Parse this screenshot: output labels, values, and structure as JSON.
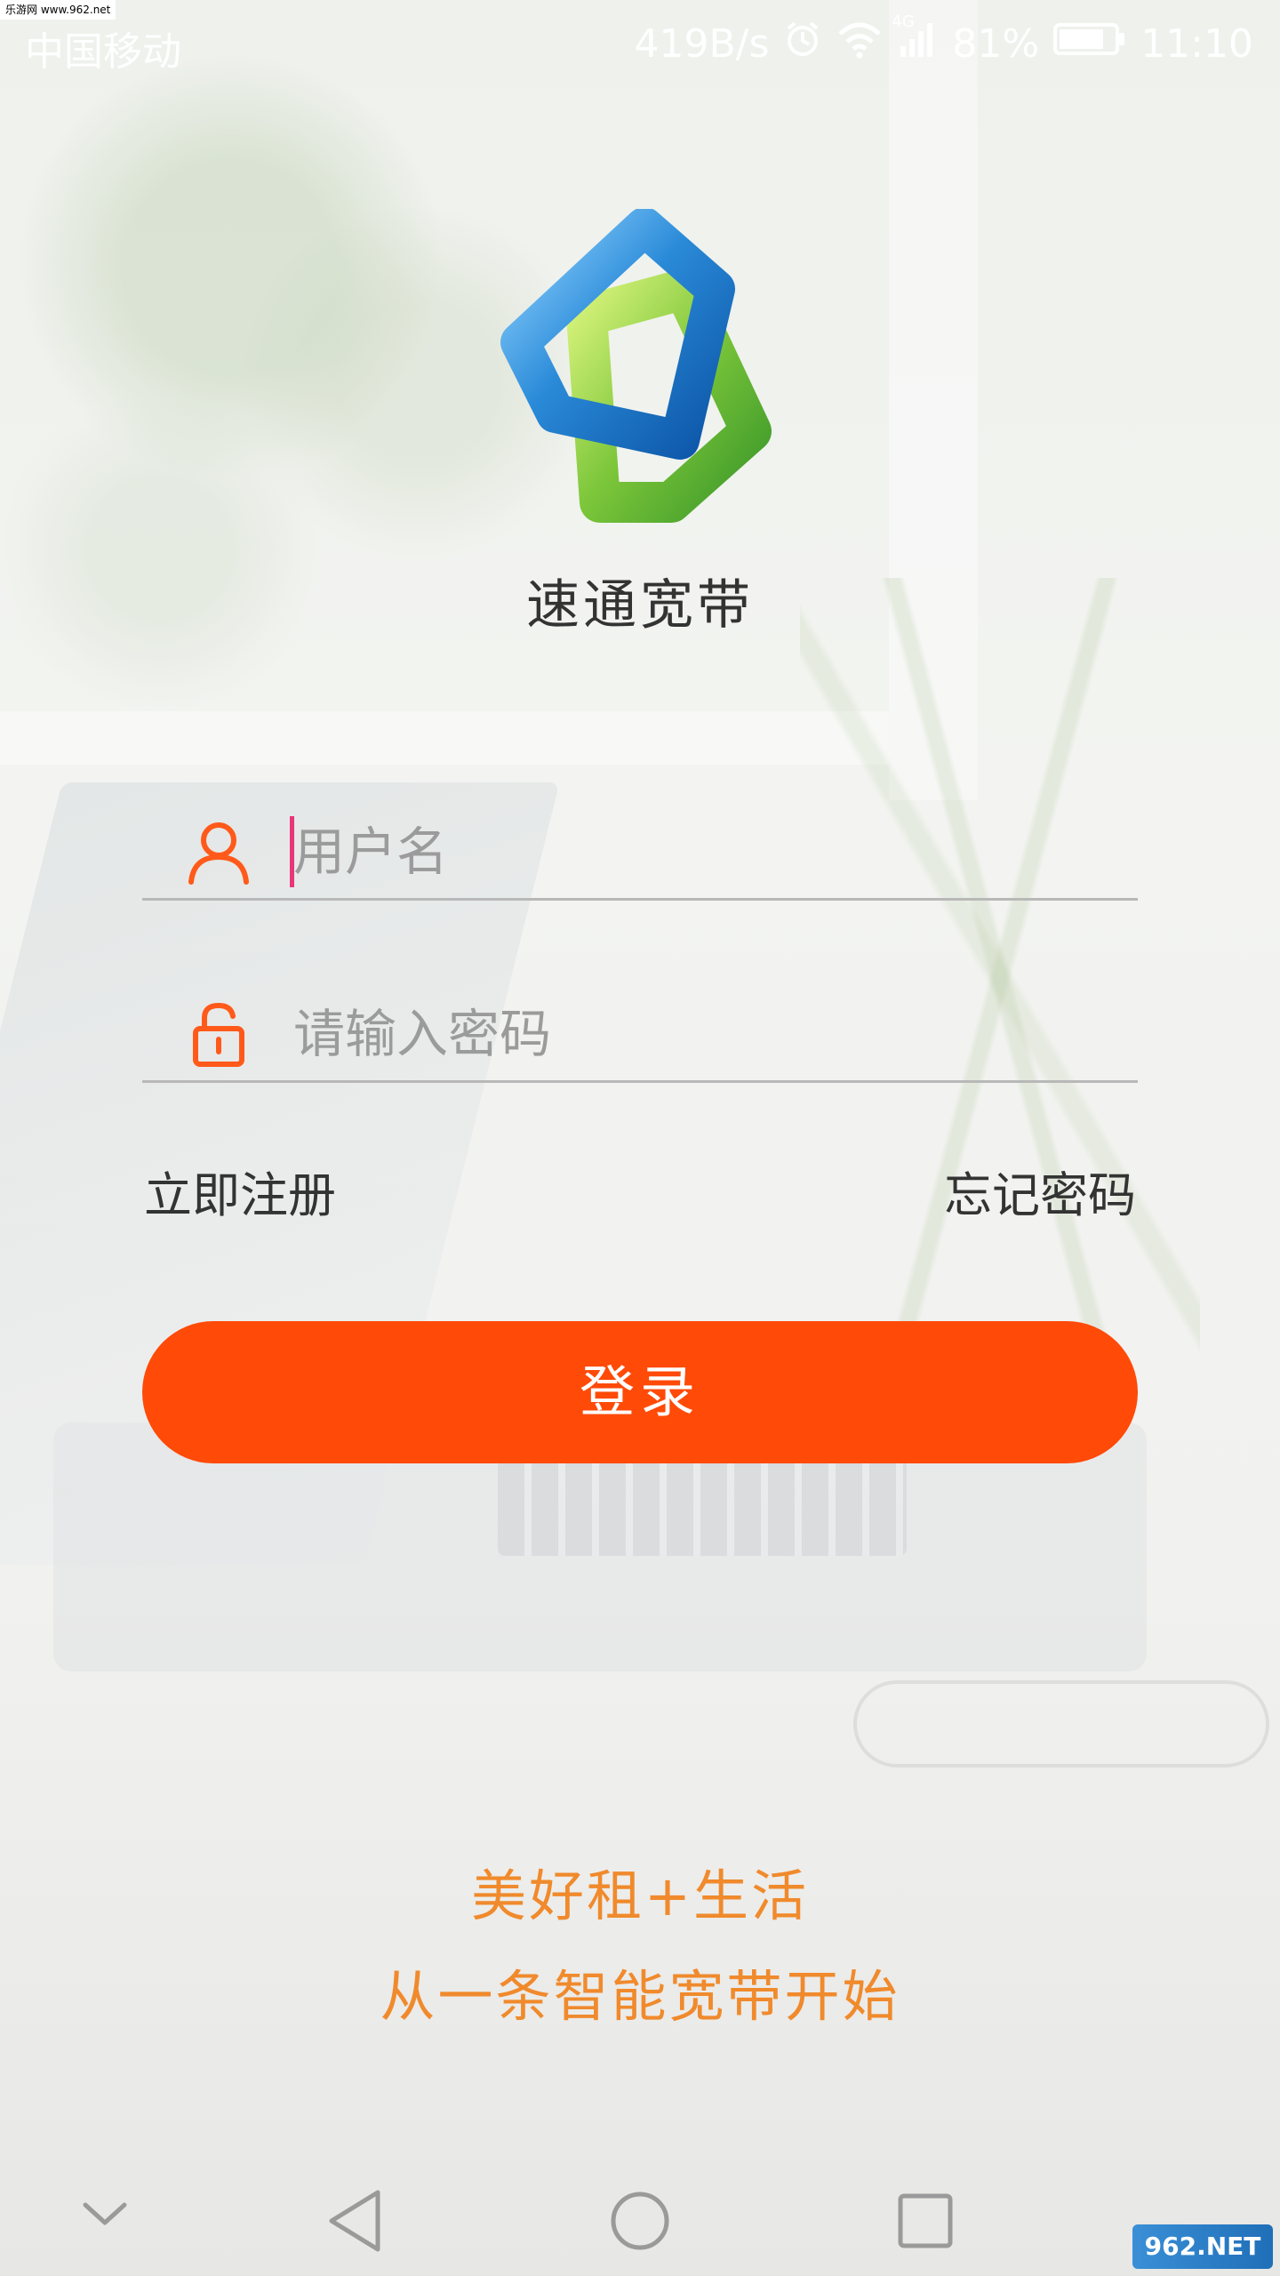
{
  "status_bar": {
    "carrier": "中国移动",
    "net_speed": "419B/s",
    "network_type": "4G",
    "battery": "81%",
    "time": "11:10"
  },
  "watermark_top": "乐游网 www.962.net",
  "app": {
    "name": "速通宽带"
  },
  "form": {
    "username_placeholder": "用户名",
    "password_placeholder": "请输入密码",
    "register_label": "立即注册",
    "forgot_label": "忘记密码",
    "login_label": "登录"
  },
  "slogan": {
    "line1": "美好租+生活",
    "line2": "从一条智能宽带开始"
  },
  "watermark_bottom": "962.NET",
  "colors": {
    "accent": "#ff4a08",
    "icon": "#ff5a1a",
    "slogan": "#f08a2c",
    "cursor": "#e8367a"
  },
  "icons": {
    "username": "user-icon",
    "password": "unlock-icon",
    "nav": [
      "chevron-down-icon",
      "back-icon",
      "home-icon",
      "recent-apps-icon"
    ]
  }
}
